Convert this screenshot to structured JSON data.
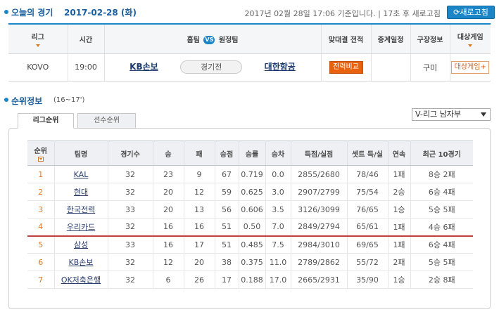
{
  "today": {
    "title": "오늘의 경기",
    "date": "2017-02-28 (화)",
    "status": "2017년 02월 28일 17:06 기준입니다. | 17초 후 새로고침",
    "refresh_label": "새로고침",
    "headers": {
      "league": "리그",
      "time": "시간",
      "home": "홈팀",
      "vs": "VS",
      "away": "원정팀",
      "head_to_head": "맞대결 전적",
      "broadcast": "중계일정",
      "stadium": "구장정보",
      "target_game": "대상게임"
    },
    "game": {
      "league": "KOVO",
      "time": "19:00",
      "home": "KB손보",
      "state": "경기전",
      "away": "대한항공",
      "compare_label": "전력비교",
      "broadcast": "",
      "stadium": "구미",
      "target_label": "대상게임+"
    }
  },
  "ranking": {
    "title": "순위정보",
    "season": "(16~17')",
    "tabs": [
      "리그순위",
      "선수순위"
    ],
    "league_select": "V-리그 남자부",
    "columns": [
      "순위",
      "팀명",
      "경기수",
      "승",
      "패",
      "승점",
      "승률",
      "승차",
      "득점/실점",
      "셋트 득/실",
      "연속",
      "최근 10경기"
    ],
    "rows": [
      [
        "1",
        "KAL",
        "32",
        "23",
        "9",
        "67",
        "0.719",
        "0.0",
        "2855/2680",
        "78/46",
        "1패",
        "8승 2패"
      ],
      [
        "2",
        "현대",
        "32",
        "20",
        "12",
        "59",
        "0.625",
        "3.0",
        "2907/2799",
        "75/54",
        "2승",
        "6승 4패"
      ],
      [
        "3",
        "한국전력",
        "33",
        "20",
        "13",
        "56",
        "0.606",
        "3.5",
        "3126/3099",
        "76/65",
        "1승",
        "5승 5패"
      ],
      [
        "4",
        "우리카드",
        "32",
        "16",
        "16",
        "51",
        "0.50",
        "7.0",
        "2849/2794",
        "65/61",
        "1패",
        "4승 6패"
      ],
      [
        "5",
        "삼성",
        "33",
        "16",
        "17",
        "51",
        "0.485",
        "7.5",
        "2984/3010",
        "69/65",
        "1패",
        "6승 4패"
      ],
      [
        "6",
        "KB손보",
        "32",
        "12",
        "20",
        "38",
        "0.375",
        "11.0",
        "2789/2862",
        "55/72",
        "2패",
        "5승 5패"
      ],
      [
        "7",
        "OK저축은행",
        "32",
        "6",
        "26",
        "17",
        "0.188",
        "17.0",
        "2665/2931",
        "35/90",
        "1승",
        "2승 8패"
      ]
    ]
  }
}
